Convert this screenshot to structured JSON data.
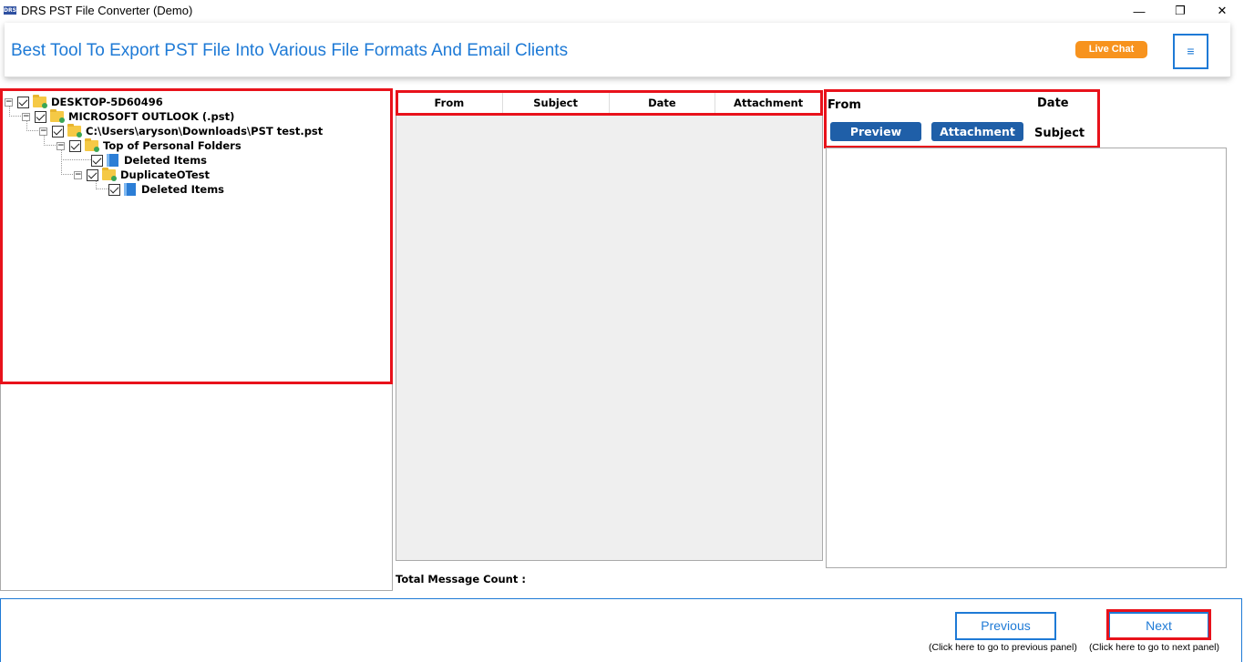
{
  "window": {
    "icon_text": "DRS",
    "title": "DRS PST File Converter (Demo)",
    "minimize_glyph": "—",
    "restore_glyph": "❐",
    "close_glyph": "✕"
  },
  "banner": {
    "title": "Best Tool To Export PST File Into Various File Formats And Email Clients",
    "live_chat": "Live Chat",
    "menu_glyph": "≡"
  },
  "tree": {
    "items": [
      {
        "label": "DESKTOP-5D60496",
        "icon": "computer-folder-icon"
      },
      {
        "label": "MICROSOFT OUTLOOK (.pst)",
        "icon": "outlook-folder-icon"
      },
      {
        "label": "C:\\Users\\aryson\\Downloads\\PST test.pst",
        "icon": "pst-folder-icon"
      },
      {
        "label": "Top of Personal Folders",
        "icon": "folder-icon"
      },
      {
        "label": "Deleted Items",
        "icon": "mail-folder-icon"
      },
      {
        "label": "DuplicateOTest",
        "icon": "folder-icon"
      },
      {
        "label": "Deleted Items",
        "icon": "mail-folder-icon"
      }
    ]
  },
  "message_list": {
    "columns": [
      "From",
      "Subject",
      "Date",
      "Attachment"
    ],
    "count_label": "Total Message Count :"
  },
  "preview": {
    "from_label": "From",
    "date_label": "Date",
    "subject_label": "Subject",
    "preview_button": "Preview",
    "attachment_button": "Attachment"
  },
  "navigation": {
    "previous": "Previous",
    "previous_hint": "(Click here to go to previous panel)",
    "next": "Next",
    "next_hint": "(Click here to go to next panel)"
  },
  "colors": {
    "accent": "#1e7ad6",
    "highlight": "#e8121b",
    "live_chat": "#f7931e",
    "button": "#1f5fa8"
  }
}
